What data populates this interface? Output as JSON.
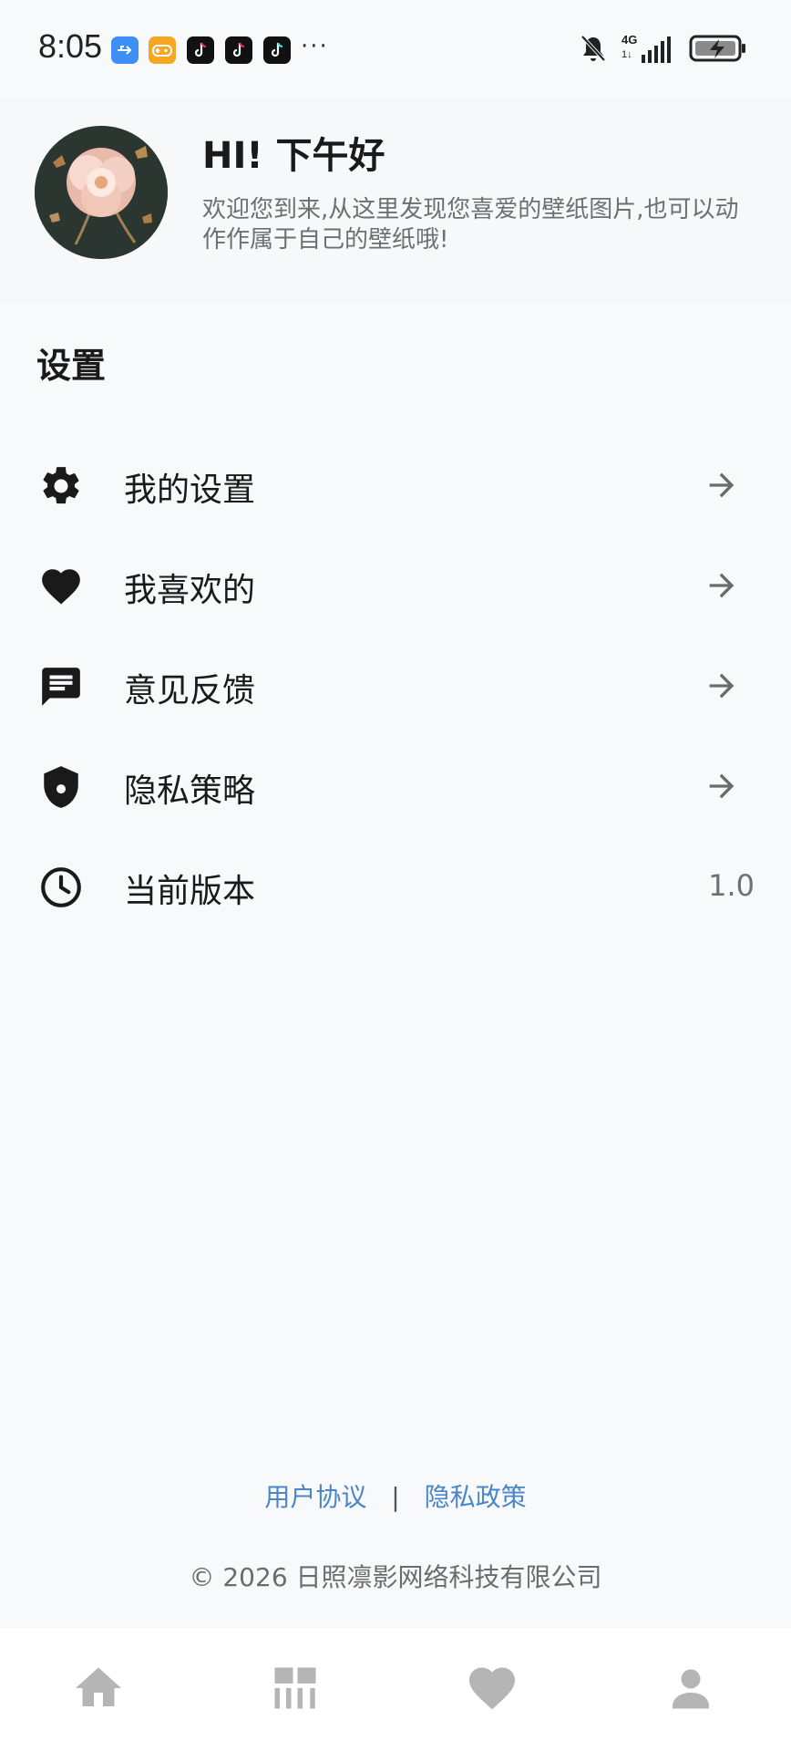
{
  "status_bar": {
    "time": "8:05",
    "icons": [
      "usb-icon",
      "game-icon",
      "tiktok-icon",
      "tiktok-icon",
      "tiktok-icon"
    ],
    "more": "···",
    "network": "4G",
    "network_sub": "1↓"
  },
  "header": {
    "title": "HI! 下午好",
    "subtitle": "欢迎您到来,从这里发现您喜爱的壁纸图片,也可以动作作属于自己的壁纸哦!"
  },
  "settings": {
    "title": "设置",
    "items": [
      {
        "label": "我的设置",
        "icon": "gear-icon"
      },
      {
        "label": "我喜欢的",
        "icon": "heart-icon"
      },
      {
        "label": "意见反馈",
        "icon": "feedback-icon"
      },
      {
        "label": "隐私策略",
        "icon": "shield-icon"
      },
      {
        "label": "当前版本",
        "icon": "clock-icon",
        "value": "1.0"
      }
    ]
  },
  "footer": {
    "user_agreement": "用户协议",
    "separator": "|",
    "privacy_policy": "隐私政策",
    "copyright": "© 2026 日照凛影网络科技有限公司"
  },
  "bottom_nav": {
    "items": [
      "home-icon",
      "grid-icon",
      "heart-icon",
      "profile-icon"
    ],
    "active_color": "#b5b5b5"
  },
  "colors": {
    "background": "#f8f9fb",
    "link": "#4a86c8",
    "icon_dark": "#1a1a1a",
    "arrow": "#6b6b6b"
  }
}
